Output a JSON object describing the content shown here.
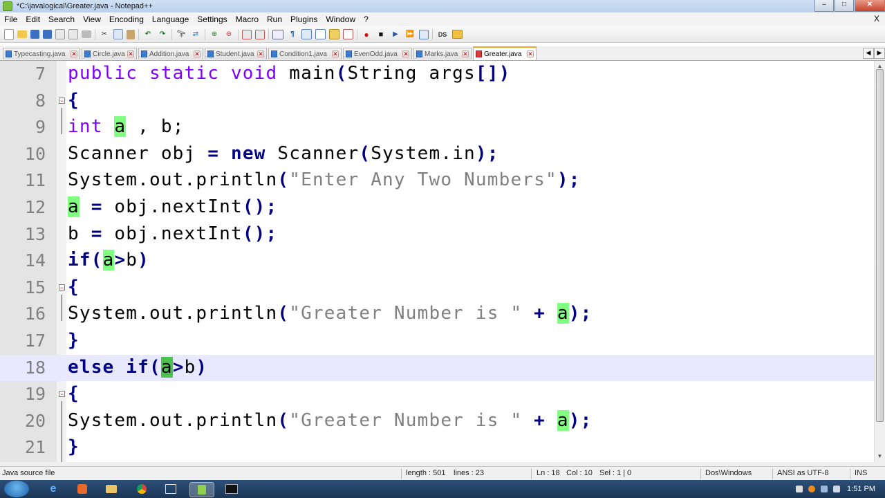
{
  "window": {
    "title": "*C:\\javalogical\\Greater.java - Notepad++",
    "controls": [
      "–",
      "□",
      "✕"
    ]
  },
  "menu": [
    "File",
    "Edit",
    "Search",
    "View",
    "Encoding",
    "Language",
    "Settings",
    "Macro",
    "Run",
    "Plugins",
    "Window",
    "?"
  ],
  "menu_close": "X",
  "toolbar_icons": [
    "new-file-icon",
    "open-file-icon",
    "save-icon",
    "save-all-icon",
    "close-icon",
    "close-all-icon",
    "print-icon",
    "cut-icon",
    "copy-icon",
    "paste-icon",
    "undo-icon",
    "redo-icon",
    "find-icon",
    "replace-icon",
    "zoom-in-icon",
    "zoom-out-icon",
    "sync-v-icon",
    "sync-h-icon",
    "word-wrap-icon",
    "show-all-chars-icon",
    "indent-guide-icon",
    "udl-icon",
    "doc-map-icon",
    "function-list-icon",
    "record-macro-icon",
    "stop-macro-icon",
    "play-macro-icon",
    "play-multiple-macro-icon",
    "save-macro-icon",
    "ds-icon",
    "plugin-icon"
  ],
  "tabs": [
    {
      "label": "Typecasting.java",
      "active": false
    },
    {
      "label": "Circle.java",
      "active": false
    },
    {
      "label": "Addition.java",
      "active": false
    },
    {
      "label": "Student.java",
      "active": false
    },
    {
      "label": "Condition1.java",
      "active": false
    },
    {
      "label": "EvenOdd.java",
      "active": false
    },
    {
      "label": "Marks.java",
      "active": false
    },
    {
      "label": "Greater.java",
      "active": true
    }
  ],
  "editor": {
    "lines": [
      {
        "num": "7"
      },
      {
        "num": "8"
      },
      {
        "num": "9"
      },
      {
        "num": "10"
      },
      {
        "num": "11"
      },
      {
        "num": "12"
      },
      {
        "num": "13"
      },
      {
        "num": "14"
      },
      {
        "num": "15"
      },
      {
        "num": "16"
      },
      {
        "num": "17"
      },
      {
        "num": "18"
      },
      {
        "num": "19"
      },
      {
        "num": "20"
      },
      {
        "num": "21"
      }
    ],
    "tokens": {
      "l7_a": "public static void ",
      "l7_b": "main",
      "l7_c": "(",
      "l7_d": "String args",
      "l7_e": "[])",
      "brace_open": "{",
      "brace_close": "}",
      "l9_a": "int",
      "l9_b": " ",
      "l9_c": "a",
      "l9_d": " , b;",
      "l10_a": "Scanner obj ",
      "l10_b": "=",
      "l10_c": " ",
      "l10_d": "new",
      "l10_e": " Scanner",
      "l10_f": "(",
      "l10_g": "System.in",
      "l10_h": ");",
      "println": "System.out.println",
      "paren_open": "(",
      "l11_str": "\"Enter Any Two Numbers\"",
      "l11_end": ");",
      "l12_a": "a",
      "l12_b": " = ",
      "l12_c": "obj.nextInt",
      "l12_d": "();",
      "l13_a": "b",
      "l13_b": " = ",
      "l13_c": "obj.nextInt",
      "l13_d": "();",
      "l14_a": "if",
      "l14_b": "(",
      "l14_c": "a",
      "l14_d": ">",
      "l14_e": "b",
      "l14_f": ")",
      "greater_str": "\"Greater Number is \"",
      "plus": " + ",
      "var_a": "a",
      "end": ");",
      "l18_a": "else if",
      "l18_b": "(",
      "l18_c": "a",
      "l18_d": ">",
      "l18_e": "b",
      "l18_f": ")"
    }
  },
  "status": {
    "file_type": "Java source file",
    "length": "length : 501",
    "lines": "lines : 23",
    "ln": "Ln : 18",
    "col": "Col : 10",
    "sel": "Sel : 1 | 0",
    "eol": "Dos\\Windows",
    "encoding": "ANSI as UTF-8",
    "mode": "INS"
  },
  "taskbar": {
    "clock": "1:51 PM"
  }
}
